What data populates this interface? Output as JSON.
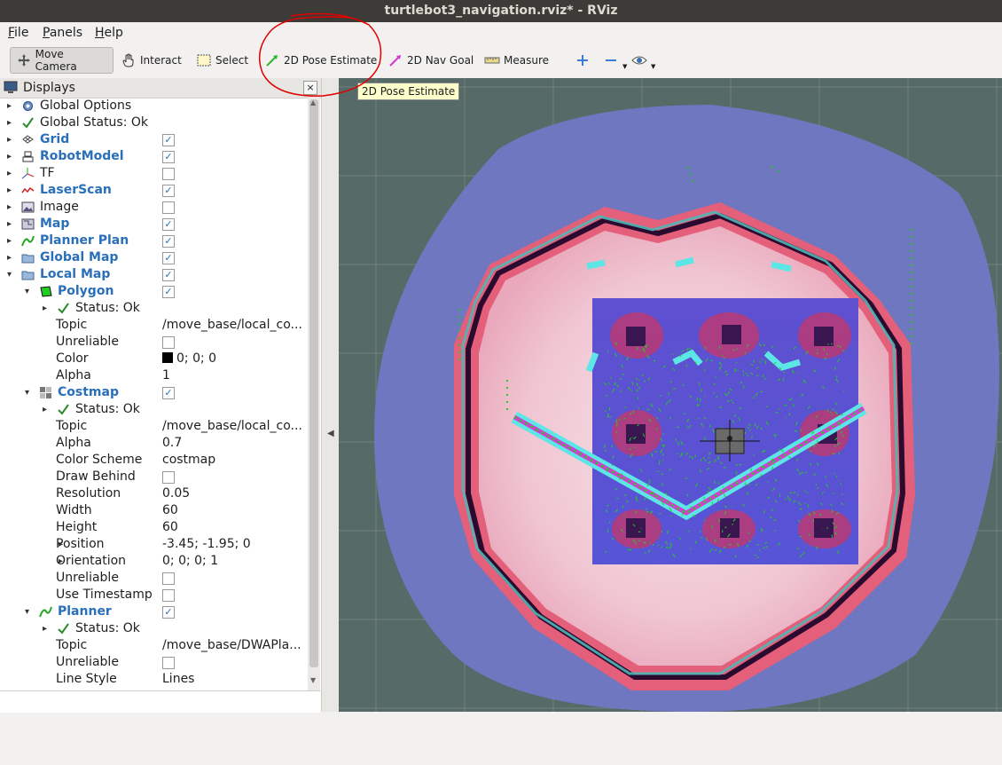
{
  "window": {
    "title": "turtlebot3_navigation.rviz* - RViz"
  },
  "menu": [
    {
      "label": "File",
      "underline": "F",
      "rest": "ile"
    },
    {
      "label": "Panels",
      "underline": "P",
      "rest": "anels"
    },
    {
      "label": "Help",
      "underline": "H",
      "rest": "elp"
    }
  ],
  "toolbar": {
    "move_camera": "Move Camera",
    "interact": "Interact",
    "select": "Select",
    "pose_estimate": "2D Pose Estimate",
    "nav_goal": "2D Nav Goal",
    "measure": "Measure",
    "tooltip": "2D Pose Estimate"
  },
  "displays": {
    "title": "Displays",
    "close_glyph": "×",
    "rows": [
      {
        "label": "Global Options",
        "icon": "gear-icon",
        "arrow": "▸",
        "check": null,
        "style": "plain"
      },
      {
        "label": "Global Status: Ok",
        "icon": "checkmark-icon",
        "arrow": "▸",
        "check": null,
        "style": "plain"
      },
      {
        "label": "Grid",
        "icon": "grid-icon",
        "arrow": "▸",
        "check": true,
        "style": "display"
      },
      {
        "label": "RobotModel",
        "icon": "robot-icon",
        "arrow": "▸",
        "check": true,
        "style": "display"
      },
      {
        "label": "TF",
        "icon": "axes-icon",
        "arrow": "▸",
        "check": false,
        "style": "plain"
      },
      {
        "label": "LaserScan",
        "icon": "laser-icon",
        "arrow": "▸",
        "check": true,
        "style": "display"
      },
      {
        "label": "Image",
        "icon": "image-icon",
        "arrow": "▸",
        "check": false,
        "style": "plain"
      },
      {
        "label": "Map",
        "icon": "map-icon",
        "arrow": "▸",
        "check": true,
        "style": "display"
      },
      {
        "label": "Planner Plan",
        "icon": "path-icon",
        "arrow": "▸",
        "check": true,
        "style": "display"
      },
      {
        "label": "Global Map",
        "icon": "folder-icon",
        "arrow": "▸",
        "check": true,
        "style": "display"
      },
      {
        "label": "Local Map",
        "icon": "folder-icon",
        "arrow": "▾",
        "check": true,
        "style": "display"
      },
      {
        "label": "Polygon",
        "icon": "polygon-icon",
        "arrow": "▾",
        "check": true,
        "style": "display"
      },
      {
        "label": "Status: Ok",
        "icon": "checkmark-icon",
        "arrow": "▸",
        "check": null,
        "style": "plain"
      },
      {
        "label": "Topic",
        "value": "/move_base/local_co...",
        "style": "prop"
      },
      {
        "label": "Unreliable",
        "check": false,
        "style": "prop"
      },
      {
        "label": "Color",
        "value": "0; 0; 0",
        "swatch": "#000000",
        "style": "prop"
      },
      {
        "label": "Alpha",
        "value": "1",
        "style": "prop"
      },
      {
        "label": "Costmap",
        "icon": "costmap-icon",
        "arrow": "▾",
        "check": true,
        "style": "display"
      },
      {
        "label": "Status: Ok",
        "icon": "checkmark-icon",
        "arrow": "▸",
        "check": null,
        "style": "plain"
      },
      {
        "label": "Topic",
        "value": "/move_base/local_co...",
        "style": "prop"
      },
      {
        "label": "Alpha",
        "value": "0.7",
        "style": "prop"
      },
      {
        "label": "Color Scheme",
        "value": "costmap",
        "style": "prop"
      },
      {
        "label": "Draw Behind",
        "check": false,
        "style": "prop"
      },
      {
        "label": "Resolution",
        "value": "0.05",
        "style": "prop"
      },
      {
        "label": "Width",
        "value": "60",
        "style": "prop"
      },
      {
        "label": "Height",
        "value": "60",
        "style": "prop"
      },
      {
        "label": "Position",
        "value": "-3.45; -1.95; 0",
        "arrow": "▸",
        "style": "prop"
      },
      {
        "label": "Orientation",
        "value": "0; 0; 0; 1",
        "arrow": "▸",
        "style": "prop"
      },
      {
        "label": "Unreliable",
        "check": false,
        "style": "prop"
      },
      {
        "label": "Use Timestamp",
        "check": false,
        "style": "prop"
      },
      {
        "label": "Planner",
        "icon": "path-icon",
        "arrow": "▾",
        "check": true,
        "style": "display"
      },
      {
        "label": "Status: Ok",
        "icon": "checkmark-icon",
        "arrow": "▸",
        "check": null,
        "style": "plain"
      },
      {
        "label": "Topic",
        "value": "/move_base/DWAPla...",
        "style": "prop"
      },
      {
        "label": "Unreliable",
        "check": false,
        "style": "prop"
      },
      {
        "label": "Line Style",
        "value": "Lines",
        "style": "prop"
      }
    ]
  },
  "colors": {
    "display_label": "#2a6fba",
    "annotation": "#e00000",
    "costmap_inflation": "#e8708a",
    "costmap_free": "#5a56c8",
    "laser": "#22cc22",
    "cyan_obstacle": "#5ce6e6"
  }
}
